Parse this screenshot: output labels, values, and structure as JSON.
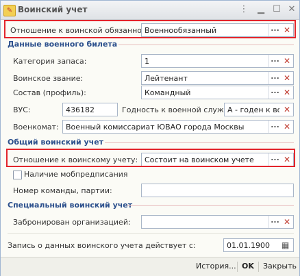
{
  "window": {
    "title": "Воинский учет"
  },
  "titlebar": {
    "icon": "record-icon",
    "buttons": [
      "more-icon",
      "minimize-icon",
      "maximize-icon",
      "close-icon"
    ]
  },
  "relation": {
    "label": "Отношение к воинской обязанности:",
    "value": "Военнообязанный"
  },
  "sections": {
    "ticket": "Данные военного билета",
    "general": "Общий воинский учет",
    "special": "Специальный воинский учет"
  },
  "ticket": {
    "category_label": "Категория запаса:",
    "category_value": "1",
    "rank_label": "Воинское звание:",
    "rank_value": "Лейтенант",
    "staff_label": "Состав (профиль):",
    "staff_value": "Командный",
    "vus_label": "ВУС:",
    "vus_value": "436182",
    "fitness_label": "Годность к военной службе:",
    "fitness_value": "А - годен к во",
    "office_label": "Военкомат:",
    "office_value": "Военный комиссариат ЮВАО города Москвы"
  },
  "general": {
    "status_label": "Отношение к воинскому учету:",
    "status_value": "Состоит на воинском учете",
    "mob_label": "Наличие мобпредписания",
    "team_label": "Номер команды, партии:",
    "team_value": ""
  },
  "special": {
    "reserved_label": "Забронирован организацией:",
    "reserved_value": ""
  },
  "record": {
    "label": "Запись о данных воинского учета действует с:",
    "date": "01.01.1900"
  },
  "footer": {
    "history": "История...",
    "ok": "OK",
    "close": "Закрыть"
  },
  "colors": {
    "highlight": "#e3242b",
    "section": "#2b4f8c"
  }
}
